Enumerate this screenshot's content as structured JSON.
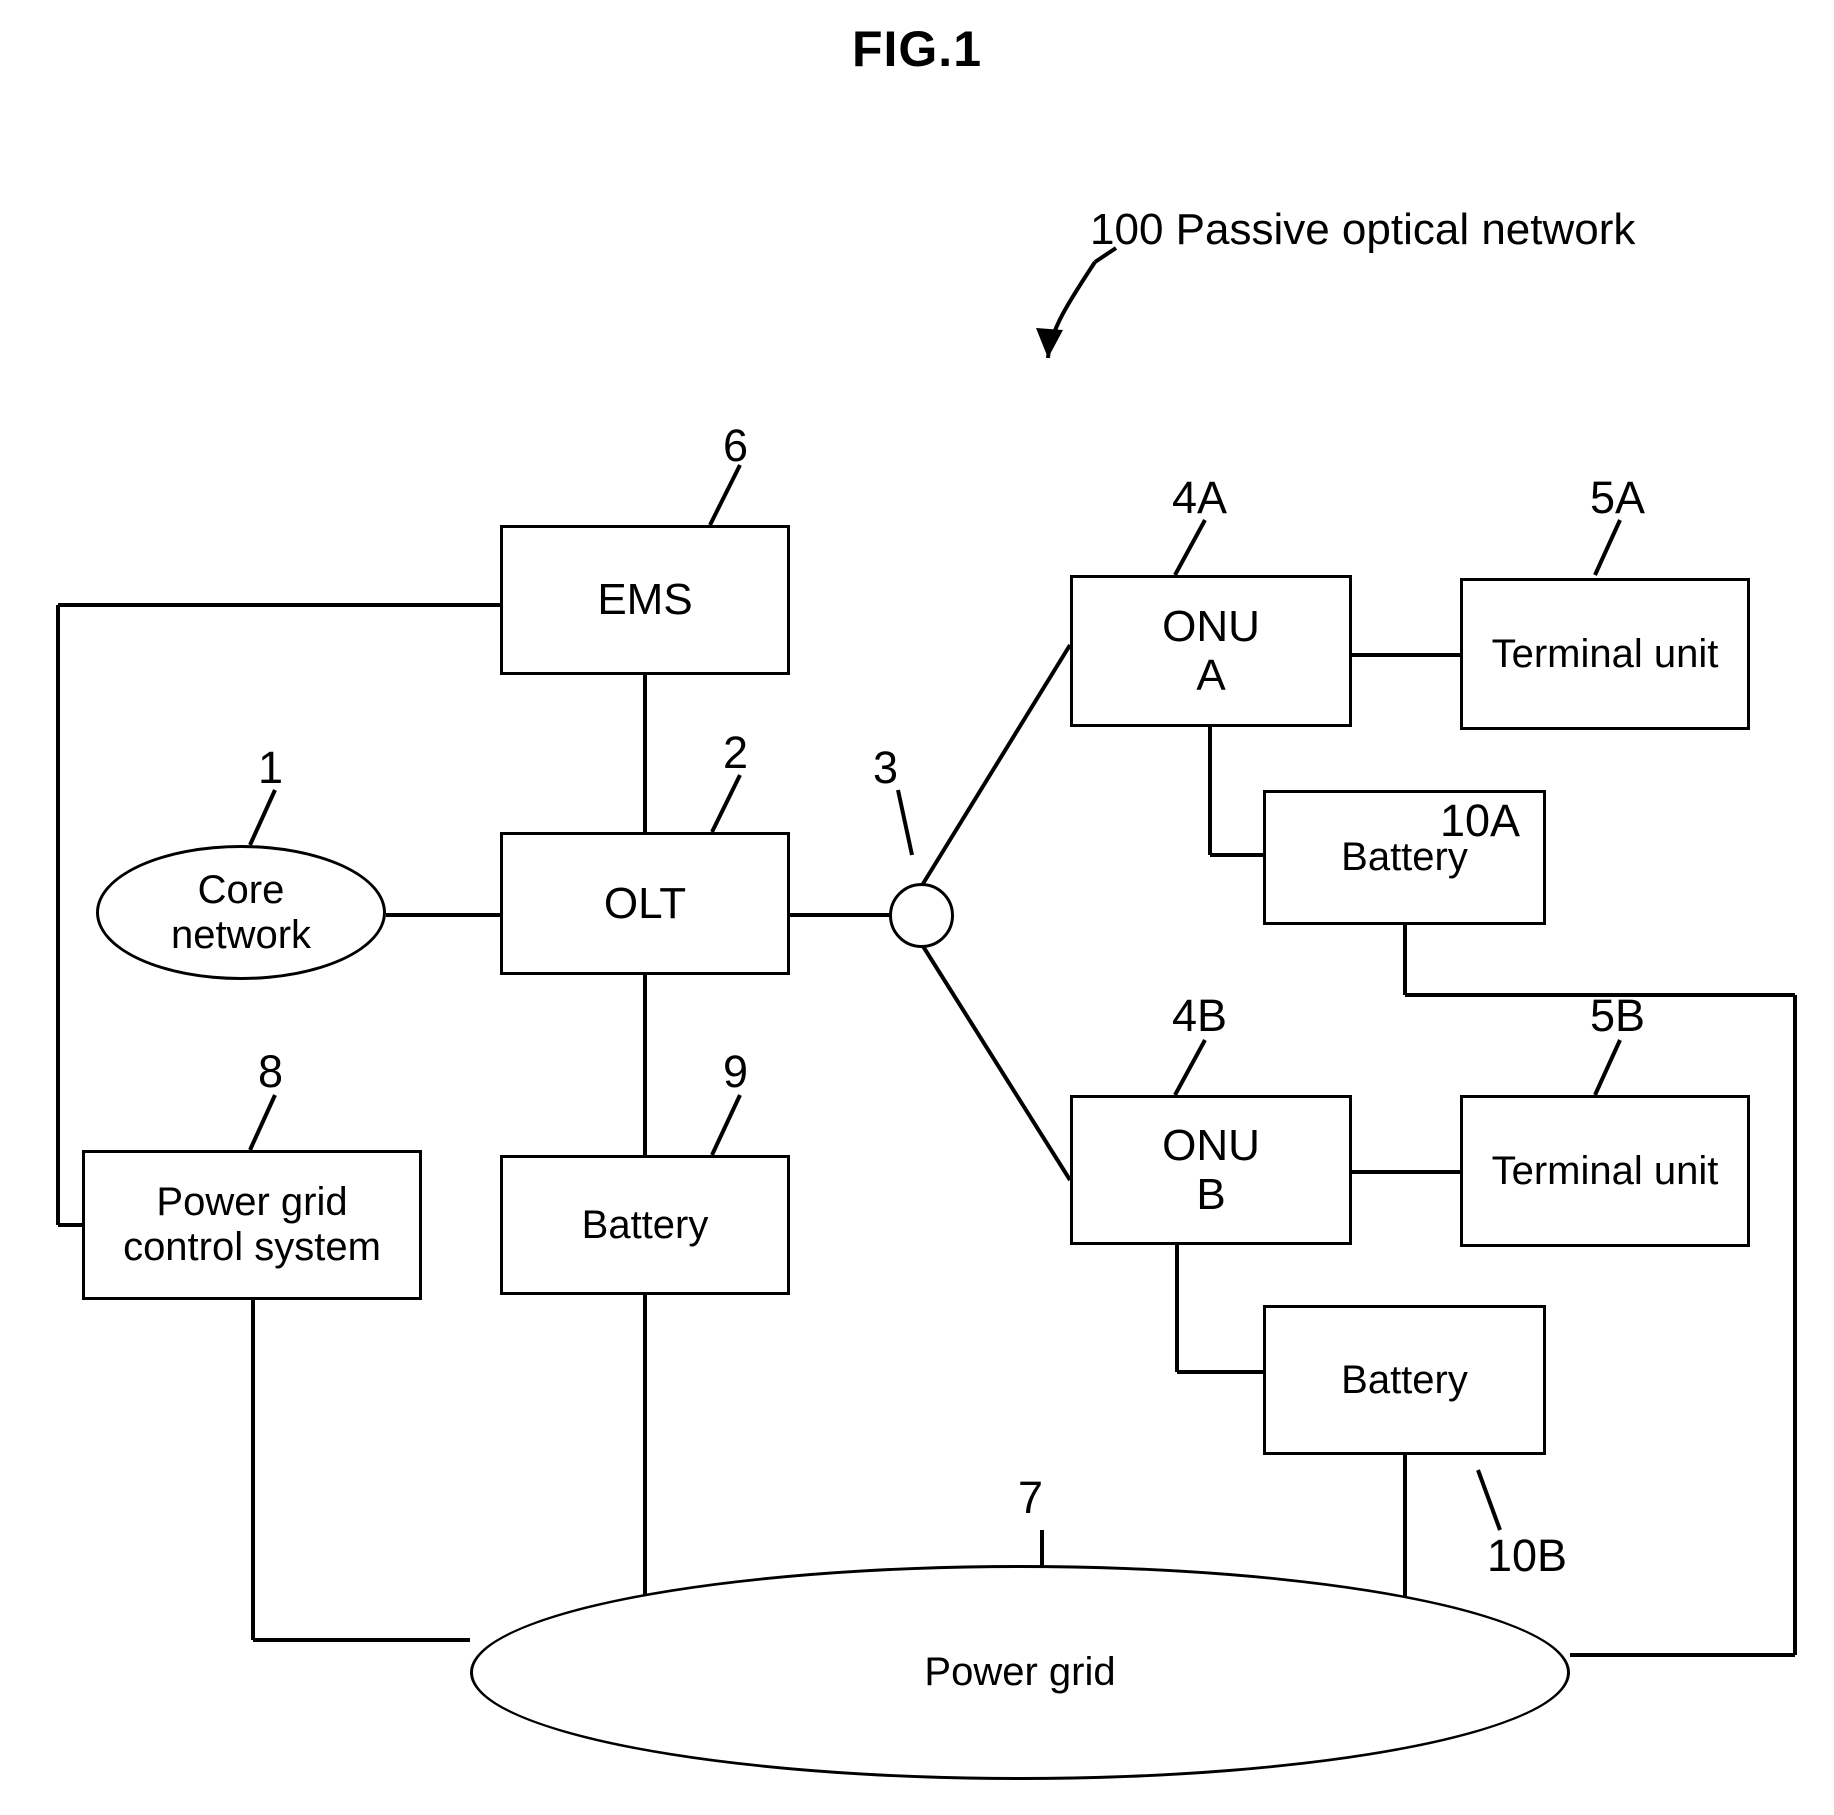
{
  "figure": {
    "title": "FIG.1",
    "annotation": "100 Passive optical network"
  },
  "nodes": {
    "core_network": {
      "label": "Core\nnetwork",
      "ref": "1"
    },
    "olt": {
      "label": "OLT",
      "ref": "2"
    },
    "splitter": {
      "label": "",
      "ref": "3"
    },
    "onu_a": {
      "label": "ONU\nA",
      "ref": "4A"
    },
    "onu_b": {
      "label": "ONU\nB",
      "ref": "4B"
    },
    "terminal_unit_a": {
      "label": "Terminal unit",
      "ref": "5A"
    },
    "terminal_unit_b": {
      "label": "Terminal unit",
      "ref": "5B"
    },
    "ems": {
      "label": "EMS",
      "ref": "6"
    },
    "power_grid": {
      "label": "Power grid",
      "ref": "7"
    },
    "power_grid_control_system": {
      "label": "Power grid\ncontrol system",
      "ref": "8"
    },
    "battery_olt": {
      "label": "Battery",
      "ref": "9"
    },
    "battery_onu_a": {
      "label": "Battery",
      "ref": "10A"
    },
    "battery_onu_b": {
      "label": "Battery",
      "ref": "10B"
    }
  },
  "colors": {
    "line": "#000000",
    "background": "#ffffff"
  }
}
